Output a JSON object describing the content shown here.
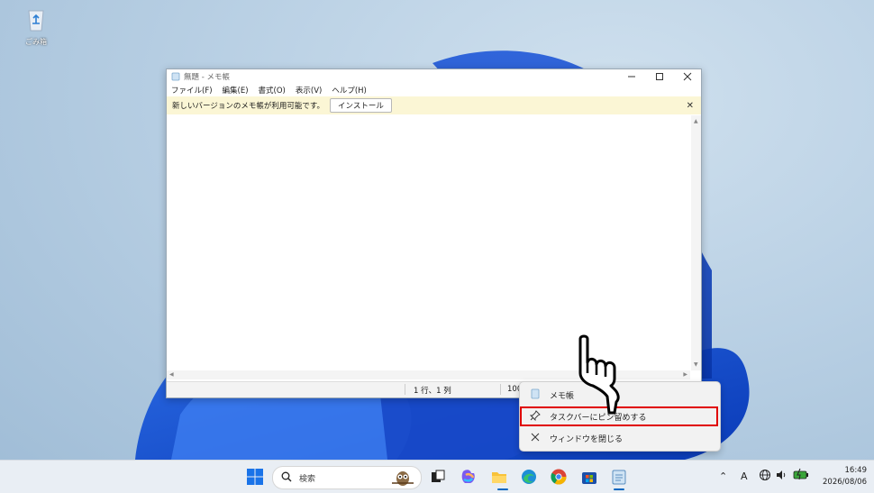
{
  "desktop": {
    "recycle_bin_label": "ごみ箱"
  },
  "window": {
    "title": "無題 - メモ帳",
    "menu": [
      "ファイル(F)",
      "編集(E)",
      "書式(O)",
      "表示(V)",
      "ヘルプ(H)"
    ],
    "notice_text": "新しいバージョンのメモ帳が利用可能です。",
    "install_button": "インストール",
    "status_position": "1 行、1 列",
    "status_zoom": "100"
  },
  "context_menu": {
    "items": [
      {
        "label": "メモ帳",
        "icon": "notepad-icon"
      },
      {
        "label": "タスクバーにピン留めする",
        "icon": "pin-icon"
      },
      {
        "label": "ウィンドウを閉じる",
        "icon": "close-icon"
      }
    ]
  },
  "taskbar": {
    "search_placeholder": "検索",
    "ime_indicator": "A",
    "time": "16:49",
    "date": "2026/08/06"
  },
  "colors": {
    "accent": "#0067c0",
    "highlight_box": "#e00000",
    "notice_bg": "#fbf6d5"
  }
}
